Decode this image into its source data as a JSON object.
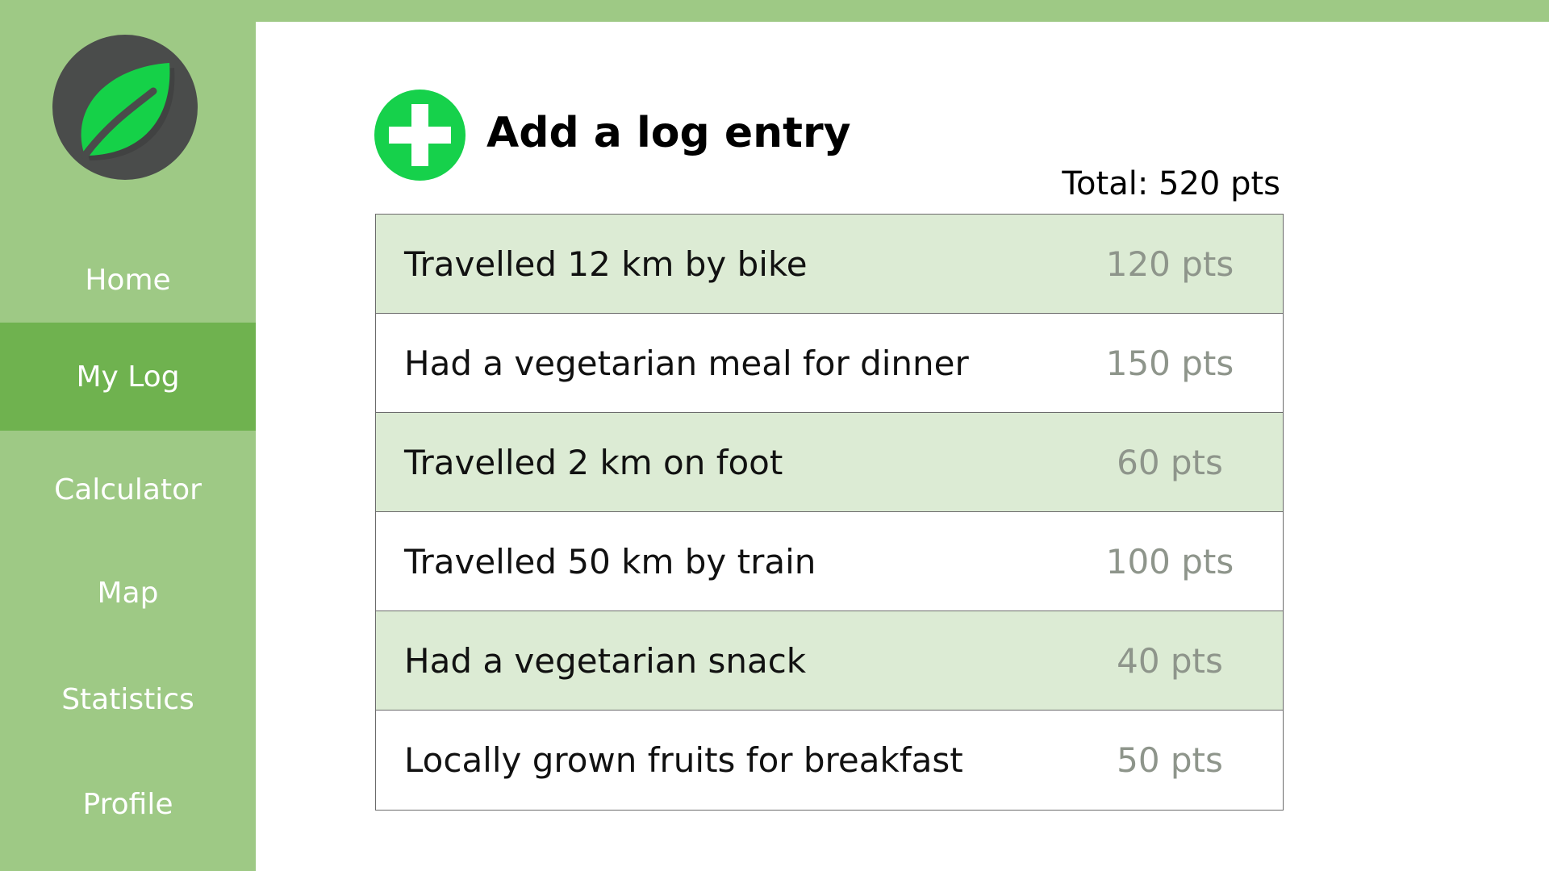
{
  "sidebar": {
    "logo_icon": "leaf-icon",
    "items": [
      {
        "label": "Home"
      },
      {
        "label": "My Log",
        "active": true
      },
      {
        "label": "Calculator"
      },
      {
        "label": "Map"
      },
      {
        "label": "Statistics"
      },
      {
        "label": "Profile"
      }
    ]
  },
  "main": {
    "add_icon": "plus-circle-icon",
    "add_title": "Add a log entry",
    "total": "Total: 520 pts",
    "entries": [
      {
        "description": "Travelled 12 km by bike",
        "points": "120 pts"
      },
      {
        "description": "Had a vegetarian meal for dinner",
        "points": "150 pts"
      },
      {
        "description": "Travelled 2 km on foot",
        "points": "60 pts"
      },
      {
        "description": "Travelled 50 km by train",
        "points": "100 pts"
      },
      {
        "description": "Had a vegetarian snack",
        "points": "40 pts"
      },
      {
        "description": "Locally grown fruits for breakfast",
        "points": "50 pts"
      }
    ]
  },
  "colors": {
    "sidebar_bg": "#9ec985",
    "sidebar_active": "#6fb24f",
    "row_shaded": "#dcebd4",
    "add_button": "#16d14b",
    "points_text": "#8e958b"
  }
}
